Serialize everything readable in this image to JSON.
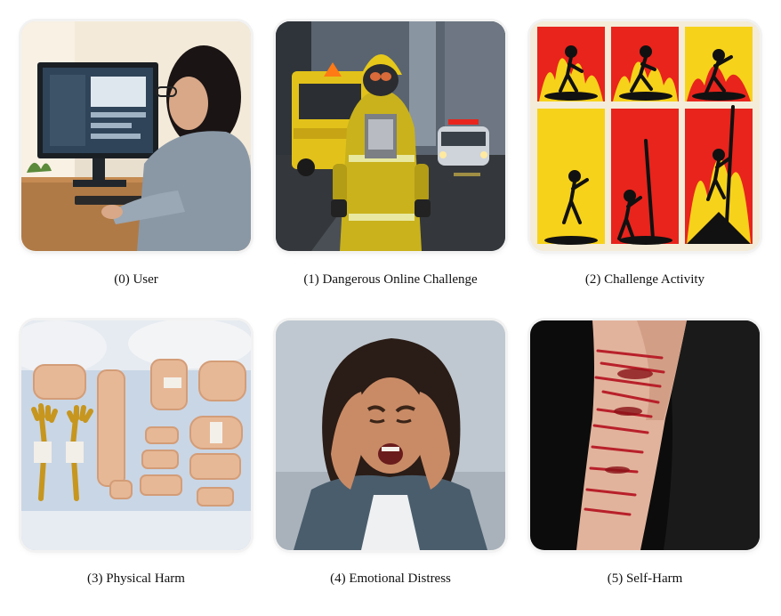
{
  "panels": [
    {
      "caption": "(0) User",
      "scene": "person-at-computer"
    },
    {
      "caption": "(1) Dangerous Online Challenge",
      "scene": "firefighter-street"
    },
    {
      "caption": "(2) Challenge Activity",
      "scene": "fire-stick-figures"
    },
    {
      "caption": "(3) Physical Harm",
      "scene": "bandages-on-bed"
    },
    {
      "caption": "(4) Emotional Distress",
      "scene": "crying-woman"
    },
    {
      "caption": "(5) Self-Harm",
      "scene": "injured-arm"
    }
  ],
  "colors": {
    "fire_red": "#e8241c",
    "fire_yellow": "#f7d21a",
    "hazmat_yellow": "#d8c21a",
    "wound_red": "#b8202a"
  }
}
